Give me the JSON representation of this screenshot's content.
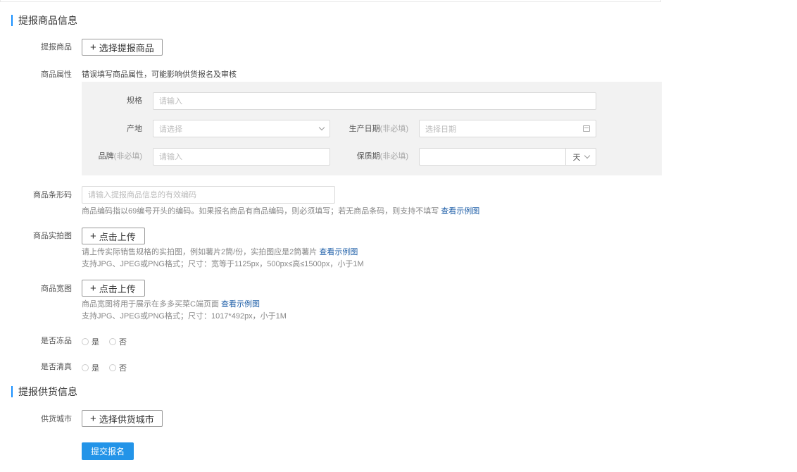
{
  "sections": {
    "goods_title": "提报商品信息",
    "supply_title": "提报供货信息"
  },
  "goods": {
    "label": "提报商品",
    "button": "选择提报商品"
  },
  "attributes": {
    "label": "商品属性",
    "warning": "错误填写商品属性，可能影响供货报名及审核",
    "spec_label": "规格",
    "spec_placeholder": "请输入",
    "origin_label": "产地",
    "origin_placeholder": "请选择",
    "prod_date_label": "生产日期",
    "prod_date_opt": "(非必填)",
    "prod_date_placeholder": "选择日期",
    "brand_label": "品牌",
    "brand_opt": "(非必填)",
    "brand_placeholder": "请输入",
    "shelf_label": "保质期",
    "shelf_opt": "(非必填)",
    "shelf_value": "",
    "shelf_unit": "天"
  },
  "barcode": {
    "label": "商品条形码",
    "placeholder": "请输入提报商品信息的有效编码",
    "hint": "商品编码指以69编号开头的编码。如果报名商品有商品编码，则必须填写；若无商品条码，则支持不填写",
    "link": "查看示例图"
  },
  "photo": {
    "label": "商品实拍图",
    "button": "点击上传",
    "hint1": "请上传实际销售规格的实拍图，例如薯片2筒/份，实拍图应是2筒薯片",
    "link": "查看示例图",
    "hint2": "支持JPG、JPEG或PNG格式；尺寸：宽等于1125px，500px≤高≤1500px，小于1M"
  },
  "wide": {
    "label": "商品宽图",
    "button": "点击上传",
    "hint1": "商品宽图将用于展示在多多买菜C端页面",
    "link": "查看示例图",
    "hint2": "支持JPG、JPEG或PNG格式；尺寸：1017*492px，小于1M"
  },
  "frozen": {
    "label": "是否冻品",
    "yes": "是",
    "no": "否"
  },
  "halal": {
    "label": "是否清真",
    "yes": "是",
    "no": "否"
  },
  "city": {
    "label": "供货城市",
    "button": "选择供货城市"
  },
  "submit": "提交报名",
  "colors": {
    "accent": "#1890ff",
    "submit_bg": "#2394e8",
    "link": "#1f5fa8",
    "panel_bg": "#f2f2f2"
  }
}
